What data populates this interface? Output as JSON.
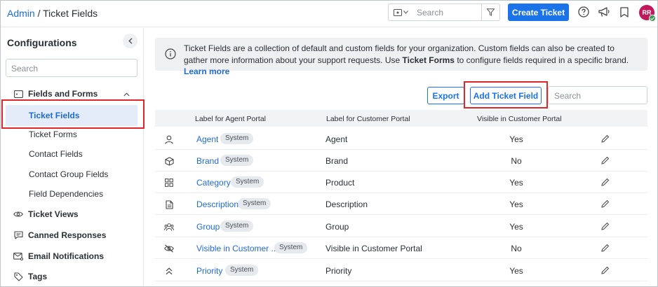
{
  "header": {
    "breadcrumb_link": "Admin",
    "breadcrumb_sep": "/",
    "breadcrumb_current": "Ticket Fields",
    "search_placeholder": "Search",
    "create_button": "Create Ticket",
    "avatar_initials": "RR"
  },
  "sidebar": {
    "title": "Configurations",
    "search_placeholder": "Search",
    "groups": [
      {
        "label": "Fields and Forms",
        "icon": "fields-forms-icon",
        "expanded": true
      },
      {
        "label": "Ticket Fields",
        "active": true
      },
      {
        "label": "Ticket Forms"
      },
      {
        "label": "Contact Fields"
      },
      {
        "label": "Contact Group Fields"
      },
      {
        "label": "Field Dependencies"
      },
      {
        "label": "Ticket Views",
        "icon": "eye-icon"
      },
      {
        "label": "Canned Responses",
        "icon": "chat-icon"
      },
      {
        "label": "Email Notifications",
        "icon": "mail-icon"
      },
      {
        "label": "Tags",
        "icon": "tag-icon"
      }
    ]
  },
  "info": {
    "text_before": "Ticket Fields are a collection of default and custom fields for your organization. Custom fields can also be created to gather more information about your support requests. Use ",
    "bold": "Ticket Forms",
    "text_after": " to configure fields required in a specific brand. ",
    "link": "Learn more"
  },
  "toolbar": {
    "export": "Export",
    "add": "Add Ticket Field",
    "search_placeholder": "Search"
  },
  "table": {
    "columns": [
      "Label for Agent Portal",
      "Label for Customer Portal",
      "Visible in Customer Portal"
    ],
    "badge": "System",
    "rows": [
      {
        "icon": "person-icon",
        "agent": "Agent",
        "customer": "Agent",
        "visible": "Yes"
      },
      {
        "icon": "cube-icon",
        "agent": "Brand",
        "customer": "Brand",
        "visible": "No"
      },
      {
        "icon": "grid-icon",
        "agent": "Category",
        "customer": "Product",
        "visible": "Yes"
      },
      {
        "icon": "document-icon",
        "agent": "Description",
        "customer": "Description",
        "visible": "Yes"
      },
      {
        "icon": "group-icon",
        "agent": "Group",
        "customer": "Group",
        "visible": "Yes"
      },
      {
        "icon": "eye-off-icon",
        "agent": "Visible in Customer ...",
        "customer": "Visible in Customer Portal",
        "visible": "No"
      },
      {
        "icon": "priority-icon",
        "agent": "Priority",
        "customer": "Priority",
        "visible": "Yes"
      }
    ]
  },
  "colors": {
    "accent": "#1a73e8",
    "highlight": "#e0262b",
    "active_bg": "#e4ecf9"
  }
}
